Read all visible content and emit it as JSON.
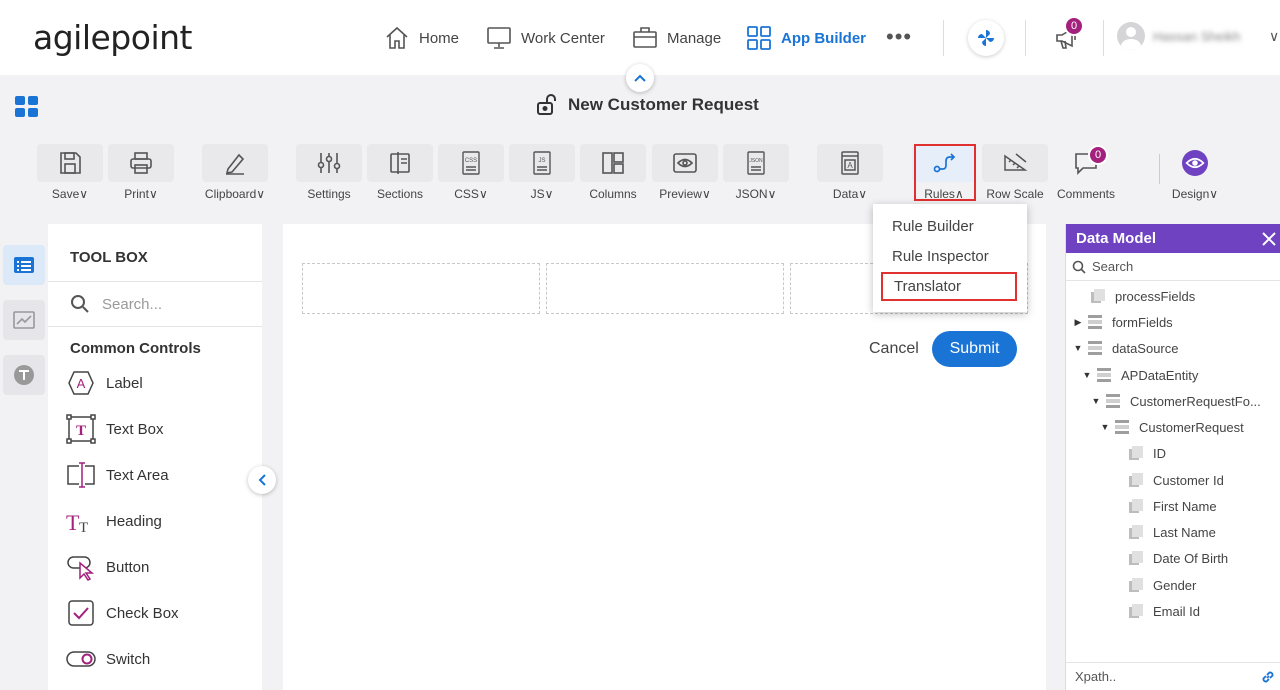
{
  "app": {
    "logo_text": "agilepoint",
    "nav": [
      {
        "label": "Home",
        "icon": "home-icon"
      },
      {
        "label": "Work Center",
        "icon": "monitor-icon"
      },
      {
        "label": "Manage",
        "icon": "briefcase-icon"
      },
      {
        "label": "App Builder",
        "icon": "app-grid-icon",
        "active": true
      }
    ],
    "more_label": "•••",
    "notifications_count": "0",
    "user_name": "Hassan Sheikh"
  },
  "page": {
    "title": "New Customer Request"
  },
  "ribbon": {
    "tools": [
      {
        "label": "Save",
        "icon": "save-icon",
        "dropdown": "true"
      },
      {
        "label": "Print",
        "icon": "print-icon",
        "dropdown": "true"
      },
      {
        "label": "Clipboard",
        "icon": "clipboard-icon",
        "dropdown": "true"
      },
      {
        "label": "Settings",
        "icon": "settings-sliders-icon"
      },
      {
        "label": "Sections",
        "icon": "sections-icon"
      },
      {
        "label": "CSS",
        "icon": "css-file-icon",
        "dropdown": "true"
      },
      {
        "label": "JS",
        "icon": "js-file-icon",
        "dropdown": "true"
      },
      {
        "label": "Columns",
        "icon": "columns-icon"
      },
      {
        "label": "Preview",
        "icon": "preview-eye-icon",
        "dropdown": "true"
      },
      {
        "label": "JSON",
        "icon": "json-file-icon",
        "dropdown": "true"
      },
      {
        "label": "Data",
        "icon": "data-icon",
        "dropdown": "true"
      },
      {
        "label": "Rules",
        "icon": "rules-icon",
        "dropdown": "open"
      },
      {
        "label": "Row Scale",
        "icon": "row-scale-icon"
      },
      {
        "label": "Comments",
        "icon": "comments-icon",
        "badge": "0"
      },
      {
        "label": "Design",
        "icon": "design-eye-icon",
        "dropdown": "true"
      }
    ],
    "chevron_down": "∨",
    "chevron_up": "∧"
  },
  "rules_menu": {
    "items": [
      "Rule Builder",
      "Rule Inspector",
      "Translator"
    ],
    "highlighted": "Translator"
  },
  "toolbox": {
    "title": "TOOL BOX",
    "search_placeholder": "Search...",
    "section": "Common Controls",
    "controls": [
      {
        "label": "Label",
        "icon": "label-control-icon"
      },
      {
        "label": "Text Box",
        "icon": "text-box-control-icon"
      },
      {
        "label": "Text Area",
        "icon": "text-area-control-icon"
      },
      {
        "label": "Heading",
        "icon": "heading-control-icon"
      },
      {
        "label": "Button",
        "icon": "button-control-icon"
      },
      {
        "label": "Check Box",
        "icon": "check-box-control-icon"
      },
      {
        "label": "Switch",
        "icon": "switch-control-icon"
      }
    ]
  },
  "canvas": {
    "cancel_label": "Cancel",
    "submit_label": "Submit"
  },
  "data_model": {
    "title": "Data Model",
    "search_placeholder": "Search",
    "xpath_placeholder": "Xpath..",
    "tree": [
      {
        "label": "processFields",
        "level": 0,
        "type": "field"
      },
      {
        "label": "formFields",
        "level": 0,
        "type": "group",
        "expand": "collapsed"
      },
      {
        "label": "dataSource",
        "level": 0,
        "type": "group",
        "expand": "expanded"
      },
      {
        "label": "APDataEntity",
        "level": 1,
        "type": "group",
        "expand": "expanded"
      },
      {
        "label": "CustomerRequestFo...",
        "level": 2,
        "type": "group",
        "expand": "expanded"
      },
      {
        "label": "CustomerRequest",
        "level": 3,
        "type": "group",
        "expand": "expanded"
      },
      {
        "label": "ID",
        "level": 4,
        "type": "field"
      },
      {
        "label": "Customer Id",
        "level": 4,
        "type": "field"
      },
      {
        "label": "First Name",
        "level": 4,
        "type": "field"
      },
      {
        "label": "Last Name",
        "level": 4,
        "type": "field"
      },
      {
        "label": "Date Of Birth",
        "level": 4,
        "type": "field"
      },
      {
        "label": "Gender",
        "level": 4,
        "type": "field"
      },
      {
        "label": "Email Id",
        "level": 4,
        "type": "field"
      }
    ]
  },
  "colors": {
    "accent": "#1a74d6",
    "data_model_header": "#6f42c1",
    "badge": "#a3207d",
    "highlight": "#e03030"
  }
}
